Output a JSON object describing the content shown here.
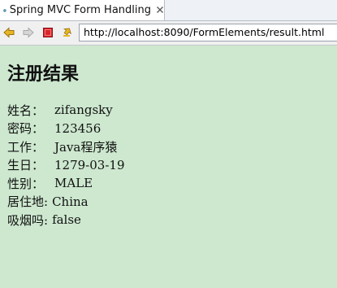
{
  "tab": {
    "title": "Spring MVC Form Handling",
    "icon": "globe-icon",
    "close_icon": "close-icon"
  },
  "toolbar": {
    "buttons": [
      "back-arrow-icon",
      "forward-arrow-icon",
      "stop-icon",
      "refresh-icon"
    ],
    "url": "http://localhost:8090/FormElements/result.html"
  },
  "page": {
    "heading": "注册结果",
    "fields": [
      {
        "label": "姓名：",
        "value": "zifangsky"
      },
      {
        "label": "密码：",
        "value": "123456"
      },
      {
        "label": "工作：",
        "value": "Java程序猿"
      },
      {
        "label": "生日：",
        "value": "1279-03-19"
      },
      {
        "label": "性别：",
        "value": "MALE"
      },
      {
        "label": "居住地:",
        "value": "China"
      },
      {
        "label": "吸烟吗:",
        "value": "false"
      }
    ]
  },
  "colors": {
    "page_background": "#cde8cf",
    "stop_red": "#d8252b",
    "arrow_yellow": "#e8b623"
  }
}
